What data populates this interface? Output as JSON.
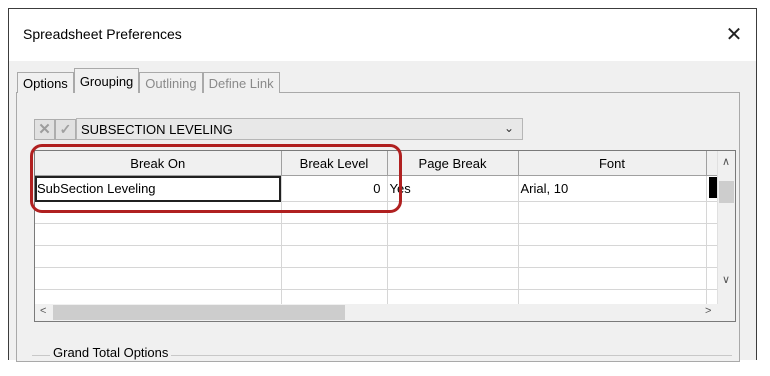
{
  "window": {
    "title": "Spreadsheet Preferences",
    "close_glyph": "✕"
  },
  "tabs": [
    {
      "label": "Options",
      "state": "normal"
    },
    {
      "label": "Grouping",
      "state": "active"
    },
    {
      "label": "Outlining",
      "state": "disabled"
    },
    {
      "label": "Define Link",
      "state": "disabled"
    }
  ],
  "toolbar": {
    "cancel_glyph": "✕",
    "accept_glyph": "✓"
  },
  "combo": {
    "value": "SUBSECTION LEVELING",
    "chevron": "⌄"
  },
  "grid": {
    "columns": [
      "Break On",
      "Break Level",
      "Page Break",
      "Font"
    ],
    "rows": [
      {
        "break_on": "SubSection Leveling",
        "break_level": "0",
        "page_break": "Yes",
        "font": "Arial, 10",
        "color": "#000000"
      }
    ]
  },
  "scroll": {
    "up": "∧",
    "down": "∨",
    "left": "<",
    "right": ">"
  },
  "group": {
    "label": "Grand Total Options"
  },
  "colors": {
    "highlight": "#b02020",
    "window_bg": "#f0f0f0"
  }
}
